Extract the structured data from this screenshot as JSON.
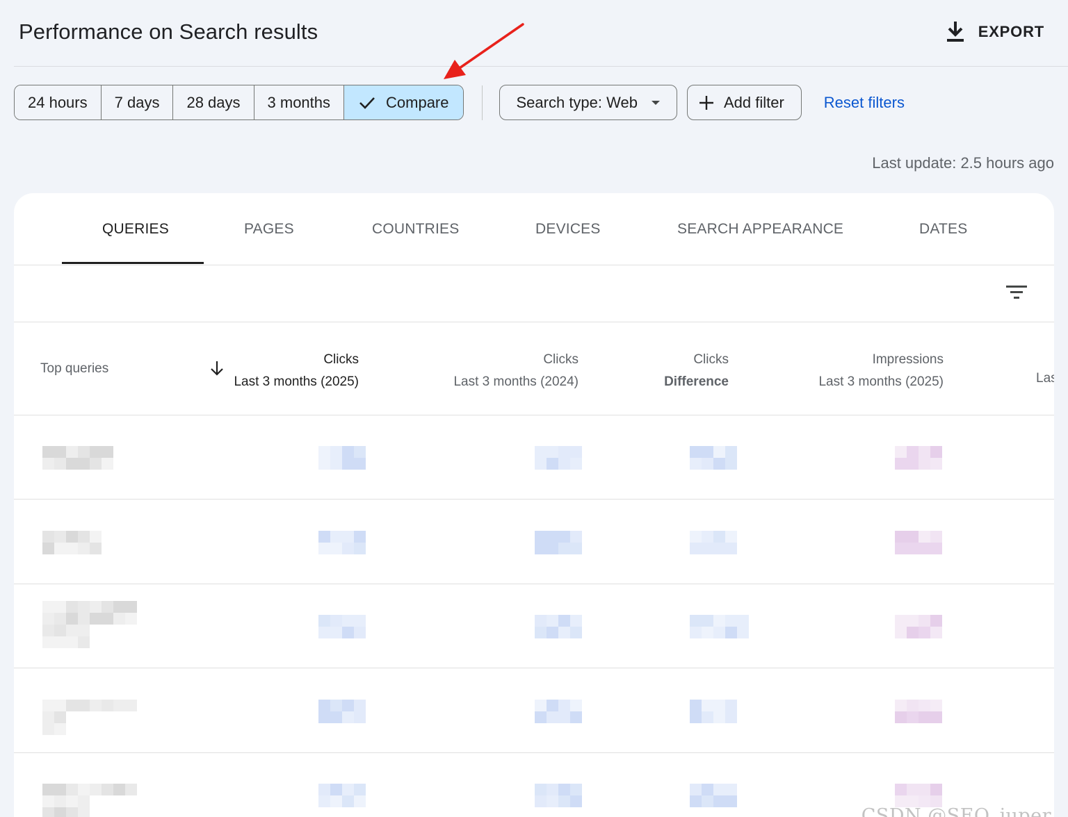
{
  "header": {
    "title": "Performance on Search results",
    "export_label": "EXPORT",
    "export_icon": "download-icon"
  },
  "date_ranges": [
    {
      "label": "24 hours",
      "selected": false
    },
    {
      "label": "7 days",
      "selected": false
    },
    {
      "label": "28 days",
      "selected": false
    },
    {
      "label": "3 months",
      "selected": false
    },
    {
      "label": "Compare",
      "selected": true
    }
  ],
  "filters": {
    "search_type": "Search type: Web",
    "add_filter": "Add filter",
    "reset": "Reset filters"
  },
  "last_update": "Last update: 2.5 hours ago",
  "tabs": [
    "QUERIES",
    "PAGES",
    "COUNTRIES",
    "DEVICES",
    "SEARCH APPEARANCE",
    "DATES"
  ],
  "active_tab": "QUERIES",
  "table": {
    "first_column": "Top queries",
    "columns": [
      {
        "line1": "Clicks",
        "line2": "Last 3 months (2025)",
        "active": true
      },
      {
        "line1": "Clicks",
        "line2": "Last 3 months (2024)",
        "active": false
      },
      {
        "line1": "Clicks",
        "line2": "Difference",
        "active": false
      },
      {
        "line1": "Impressions",
        "line2": "Last 3 months (2025)",
        "active": false
      }
    ],
    "clipped_column": "Las"
  },
  "colors": {
    "accent": "#0b57d0",
    "selected_chip": "#c2e7ff",
    "annotation_arrow": "#e8211b"
  },
  "watermark": "CSDN @SEO_juper"
}
